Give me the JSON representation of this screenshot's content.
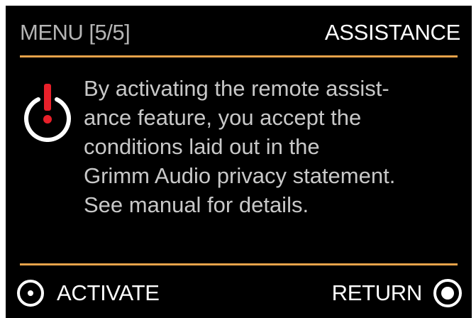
{
  "header": {
    "menu_label": "MENU [5/5]",
    "title": "ASSISTANCE"
  },
  "notice": {
    "icon": "power-warning-icon",
    "lines": [
      "By activating the remote assist-",
      "ance feature, you accept the",
      "conditions laid out in the",
      "Grimm Audio privacy statement.",
      "See manual for details."
    ]
  },
  "footer": {
    "activate": {
      "label": "ACTIVATE",
      "icon": "radio-button-icon"
    },
    "return": {
      "label": "RETURN",
      "icon": "radio-button-selected-icon"
    }
  },
  "colors": {
    "background": "#000000",
    "accent": "#e6a24a",
    "warning": "#e8202a",
    "text": "#c8c8c8",
    "label": "#ffffff"
  }
}
